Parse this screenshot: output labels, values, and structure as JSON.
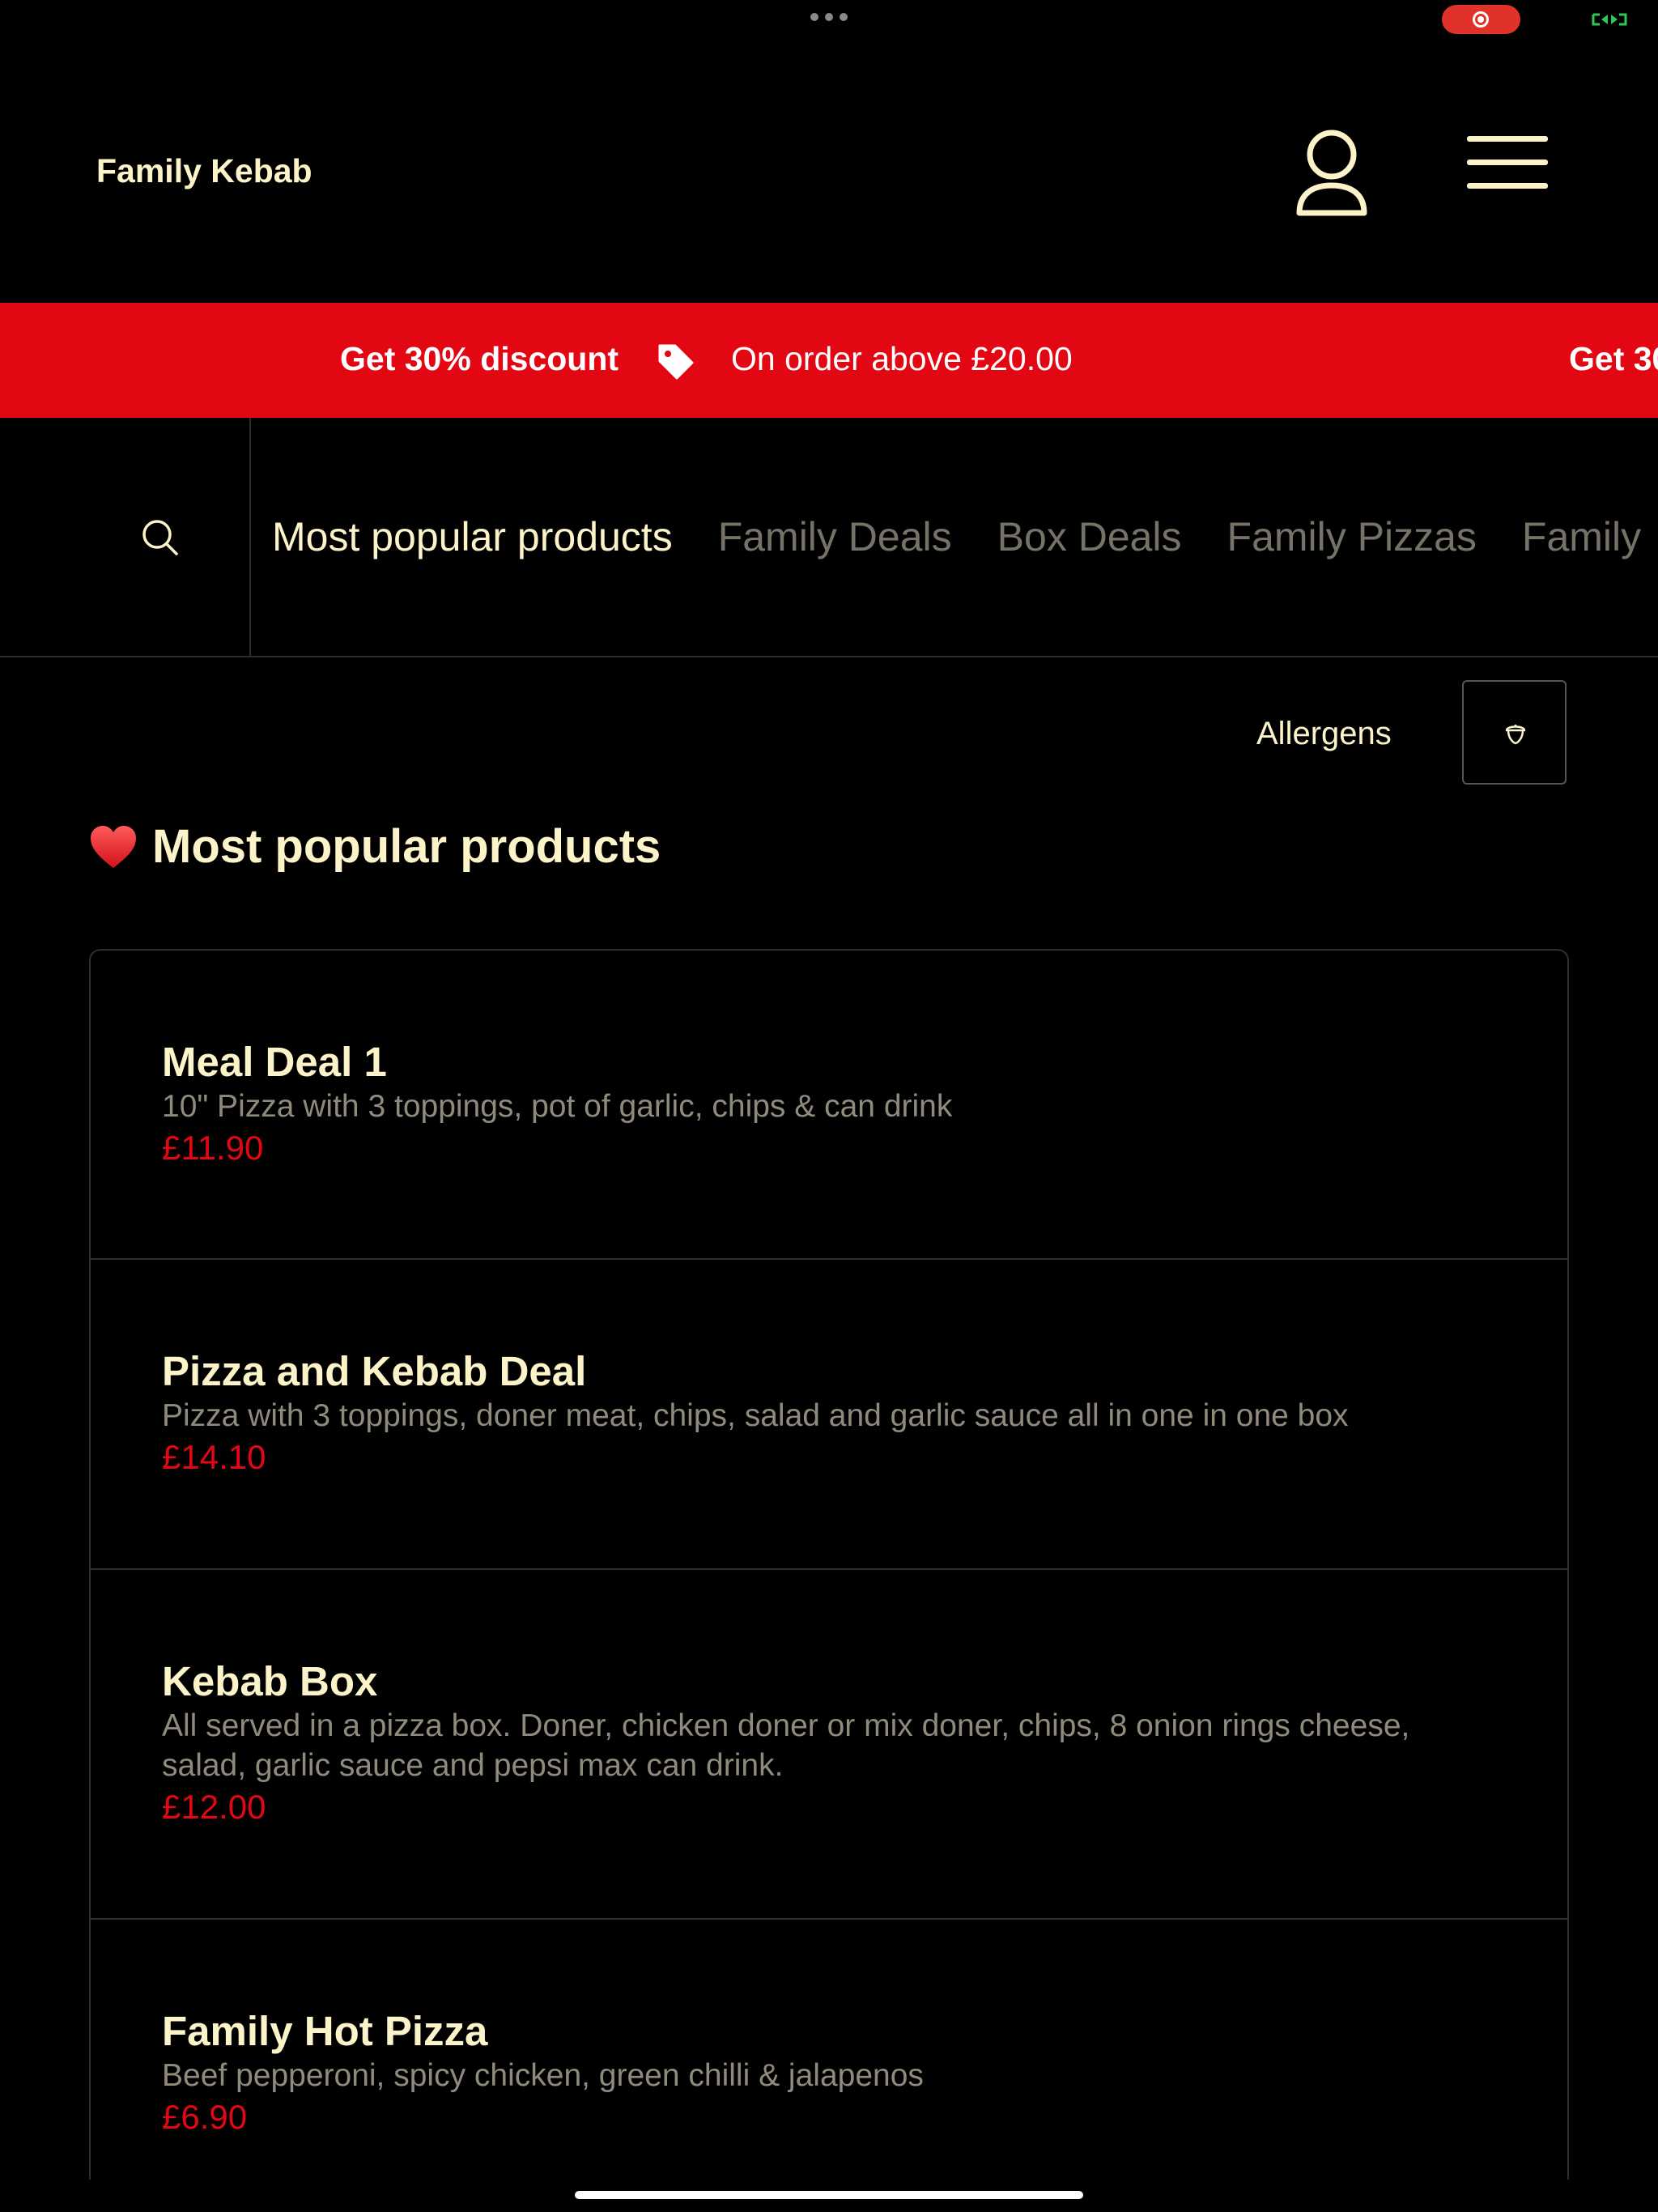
{
  "header": {
    "brand": "Family Kebab"
  },
  "promo": {
    "headline": "Get 30% discount",
    "detail": "On order above £20.00",
    "repeat": "Get 30"
  },
  "nav": {
    "categories": [
      {
        "label": "Most popular products",
        "active": true
      },
      {
        "label": "Family Deals",
        "active": false
      },
      {
        "label": "Box Deals",
        "active": false
      },
      {
        "label": "Family Pizzas",
        "active": false
      },
      {
        "label": "Family",
        "active": false
      }
    ]
  },
  "allergens": {
    "label": "Allergens"
  },
  "section": {
    "title": "Most popular products",
    "icon": "heart-icon"
  },
  "products": [
    {
      "name": "Meal Deal 1",
      "description": "10\" Pizza with 3 toppings, pot of garlic, chips & can drink",
      "price": "£11.90"
    },
    {
      "name": "Pizza and Kebab Deal",
      "description": "Pizza with 3 toppings, doner meat, chips, salad and garlic sauce all in one in one box",
      "price": "£14.10"
    },
    {
      "name": "Kebab Box",
      "description": "All served in a pizza box. Doner, chicken doner or mix doner, chips, 8 onion rings cheese, salad, garlic sauce and pepsi max can drink.",
      "price": "£12.00"
    },
    {
      "name": "Family Hot Pizza",
      "description": "Beef pepperoni, spicy chicken, green chilli & jalapenos",
      "price": "£6.90"
    }
  ],
  "colors": {
    "accent": "#e30613",
    "text": "#fdf3c9",
    "muted": "#8f8a7c",
    "background": "#000000"
  }
}
